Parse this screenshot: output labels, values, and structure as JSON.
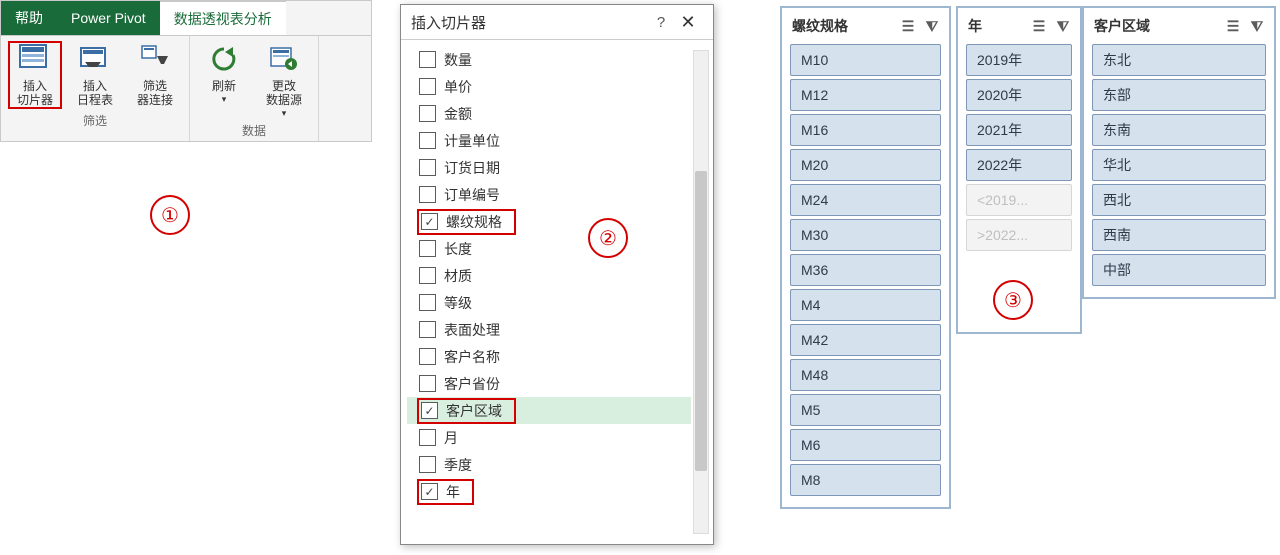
{
  "ribbon": {
    "tabs": {
      "help": "帮助",
      "pivot": "Power Pivot",
      "analyze": "数据透视表分析"
    },
    "buttons": {
      "insert_slicer": "插入\n切片器",
      "insert_timeline": "插入\n日程表",
      "filter_conn": "筛选\n器连接",
      "refresh": "刷新",
      "change_source": "更改\n数据源"
    },
    "groups": {
      "filter": "筛选",
      "data": "数据"
    }
  },
  "dialog": {
    "title": "插入切片器",
    "fields": [
      {
        "label": "数量",
        "checked": false
      },
      {
        "label": "单价",
        "checked": false
      },
      {
        "label": "金额",
        "checked": false
      },
      {
        "label": "计量单位",
        "checked": false
      },
      {
        "label": "订货日期",
        "checked": false
      },
      {
        "label": "订单编号",
        "checked": false
      },
      {
        "label": "螺纹规格",
        "checked": true,
        "highlight": true
      },
      {
        "label": "长度",
        "checked": false
      },
      {
        "label": "材质",
        "checked": false
      },
      {
        "label": "等级",
        "checked": false
      },
      {
        "label": "表面处理",
        "checked": false
      },
      {
        "label": "客户名称",
        "checked": false
      },
      {
        "label": "客户省份",
        "checked": false
      },
      {
        "label": "客户区域",
        "checked": true,
        "highlight": true,
        "selected": true
      },
      {
        "label": "月",
        "checked": false
      },
      {
        "label": "季度",
        "checked": false
      },
      {
        "label": "年",
        "checked": true,
        "highlight": true
      }
    ]
  },
  "slicers": {
    "spec": {
      "title": "螺纹规格",
      "items": [
        "M10",
        "M12",
        "M16",
        "M20",
        "M24",
        "M30",
        "M36",
        "M4",
        "M42",
        "M48",
        "M5",
        "M6",
        "M8"
      ]
    },
    "year": {
      "title": "年",
      "items": [
        "2019年",
        "2020年",
        "2021年",
        "2022年"
      ],
      "dim_items": [
        "<2019...",
        ">2022..."
      ]
    },
    "region": {
      "title": "客户区域",
      "items": [
        "东北",
        "东部",
        "东南",
        "华北",
        "西北",
        "西南",
        "中部"
      ]
    }
  },
  "annotations": {
    "a1": "①",
    "a2": "②",
    "a3": "③"
  }
}
